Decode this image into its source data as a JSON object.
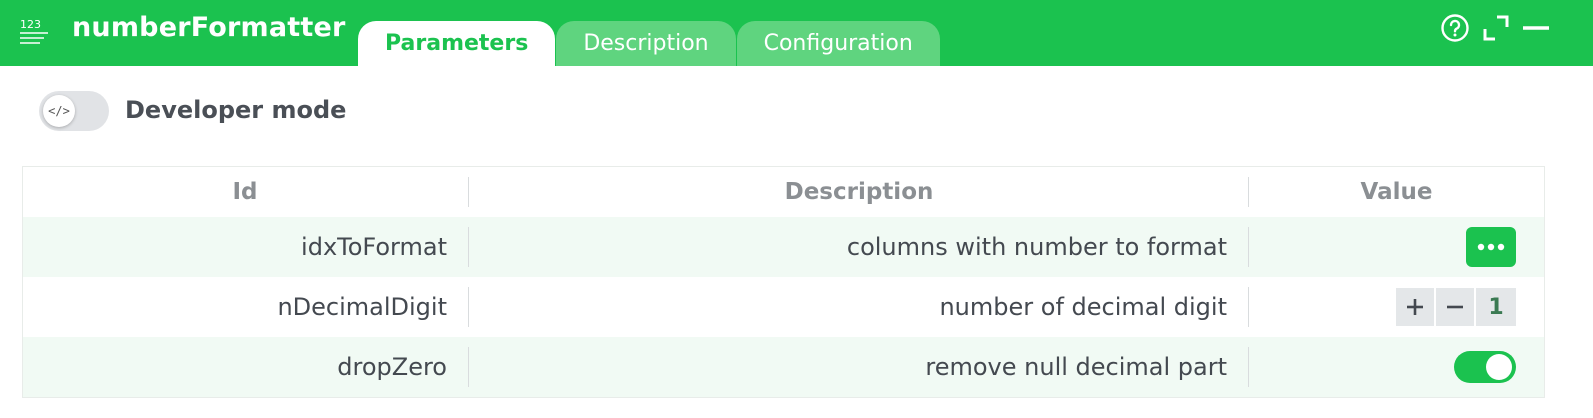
{
  "app": {
    "icon": "number-format-icon",
    "title": "numberFormatter"
  },
  "tabs": [
    {
      "label": "Parameters",
      "active": true
    },
    {
      "label": "Description",
      "active": false
    },
    {
      "label": "Configuration",
      "active": false
    }
  ],
  "header_actions": [
    {
      "icon": "help-icon"
    },
    {
      "icon": "expand-icon"
    },
    {
      "icon": "minimize-icon"
    }
  ],
  "developer_mode": {
    "label": "Developer mode",
    "icon_text": "</>",
    "enabled": false
  },
  "table": {
    "columns": [
      "Id",
      "Description",
      "Value"
    ],
    "rows": [
      {
        "id": "idxToFormat",
        "description": "columns with number to format",
        "value_type": "more-button"
      },
      {
        "id": "nDecimalDigit",
        "description": "number of decimal digit",
        "value_type": "stepper",
        "value": "1"
      },
      {
        "id": "dropZero",
        "description": "remove null decimal part",
        "value_type": "toggle",
        "enabled": true
      }
    ]
  },
  "colors": {
    "accent": "#1bc24f",
    "tab_inactive": "#5fd47f",
    "row_alt": "#f1faf4"
  }
}
